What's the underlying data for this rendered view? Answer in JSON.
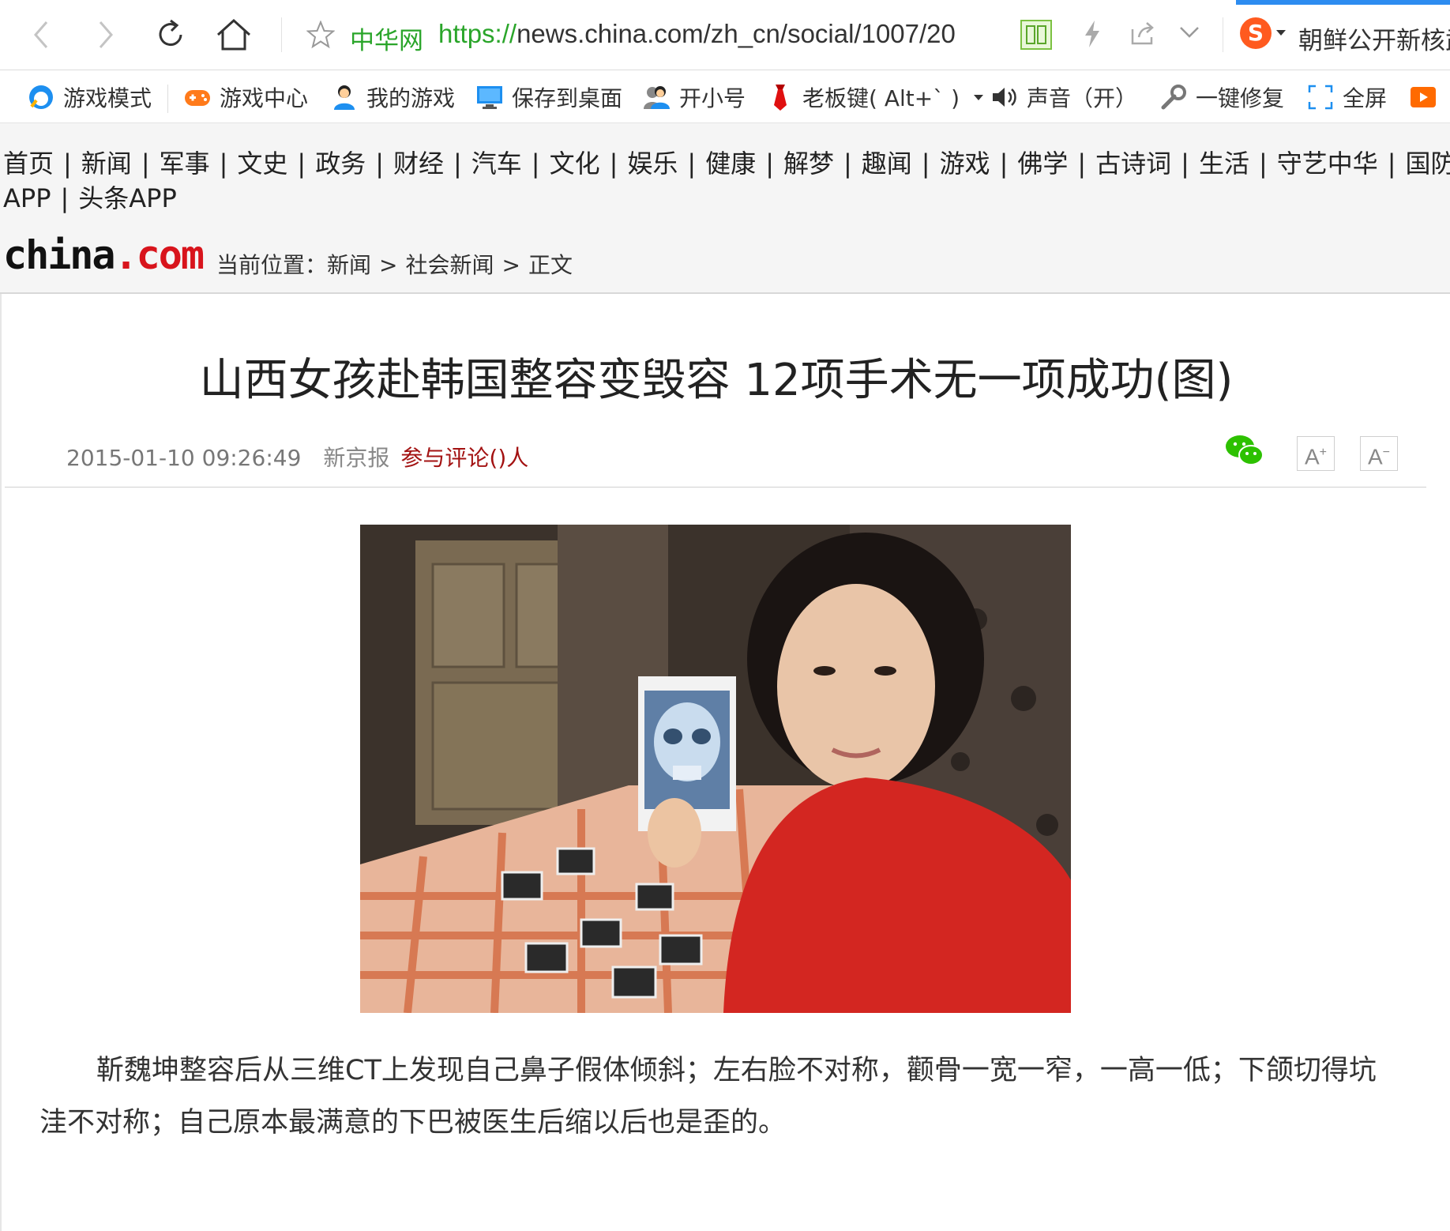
{
  "browser": {
    "site_label": "中华网",
    "url_scheme": "https://",
    "url_rest": "news.china.com/zh_cn/social/1007/20",
    "search_hint": "朝鲜公开新核武"
  },
  "toolbar": {
    "items": [
      {
        "label": "游戏模式",
        "icon": "game-mode-icon"
      },
      {
        "label": "游戏中心",
        "icon": "gamepad-icon"
      },
      {
        "label": "我的游戏",
        "icon": "user-icon"
      },
      {
        "label": "保存到桌面",
        "icon": "monitor-icon"
      },
      {
        "label": "开小号",
        "icon": "multi-user-icon"
      },
      {
        "label": "老板键( Alt+` )",
        "icon": "tie-icon"
      },
      {
        "label": "声音（开）",
        "icon": "speaker-icon"
      },
      {
        "label": "一键修复",
        "icon": "wrench-icon"
      },
      {
        "label": "全屏",
        "icon": "fullscreen-icon"
      }
    ]
  },
  "sitenav": {
    "line1": [
      "首页",
      "新闻",
      "军事",
      "文史",
      "政务",
      "财经",
      "汽车",
      "文化",
      "娱乐",
      "健康",
      "解梦",
      "趣闻",
      "游戏",
      "佛学",
      "古诗词",
      "生活",
      "守艺中华",
      "国防"
    ],
    "line2": [
      "APP",
      "头条APP"
    ]
  },
  "logo": {
    "part1": "china",
    "part2": ".com"
  },
  "breadcrumb": {
    "prefix": "当前位置：",
    "items": [
      "新闻",
      "社会新闻",
      "正文"
    ],
    "separator": ">"
  },
  "article": {
    "title": "山西女孩赴韩国整容变毁容 12项手术无一项成功(图)",
    "date": "2015-01-10 09:26:49",
    "source": "新京报",
    "comments": "参与评论()人",
    "font_increase": "A",
    "font_decrease": "A",
    "body": "靳魏坤整容后从三维CT上发现自己鼻子假体倾斜；左右脸不对称，颧骨一宽一窄，一高一低；下颌切得坑洼不对称；自己原本最满意的下巴被医生后缩以后也是歪的。"
  },
  "colors": {
    "accent_green": "#2aa52a",
    "brand_red": "#d8141c",
    "comment_red": "#a31212"
  }
}
